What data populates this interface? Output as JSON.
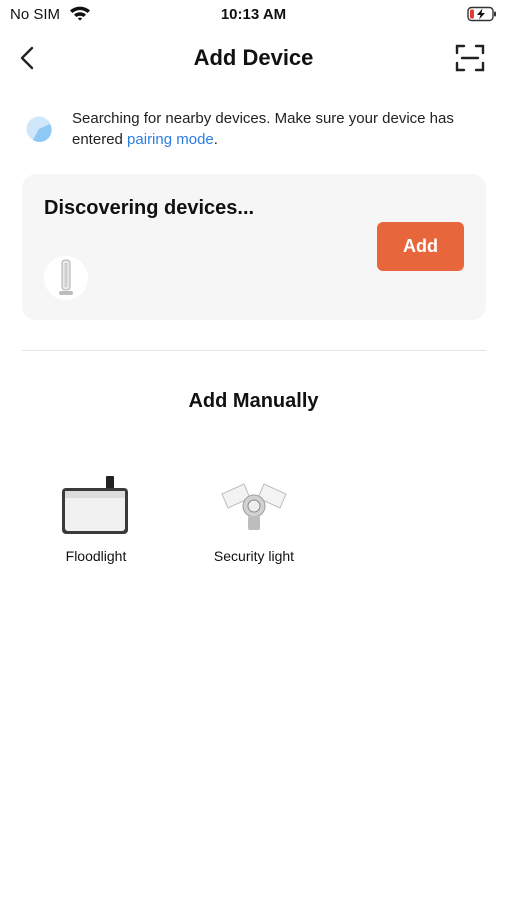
{
  "status_bar": {
    "carrier": "No SIM",
    "time": "10:13 AM",
    "wifi_icon": "wifi-icon",
    "battery_icon": "battery-charging-icon"
  },
  "nav": {
    "title": "Add Device",
    "back_icon": "chevron-left-icon",
    "scan_icon": "scan-icon"
  },
  "notice": {
    "text_before": "Searching for nearby devices. Make sure your device has entered ",
    "link": "pairing mode",
    "text_after": "."
  },
  "discover": {
    "title": "Discovering devices...",
    "add_label": "Add",
    "device_icon": "tower-fan-device-icon"
  },
  "manual": {
    "title": "Add Manually",
    "devices": [
      {
        "label": "Floodlight",
        "icon": "floodlight-icon"
      },
      {
        "label": "Security light",
        "icon": "security-light-icon"
      }
    ]
  },
  "colors": {
    "accent": "#e8663c",
    "link": "#2b7de0",
    "card_bg": "#f6f6f6"
  }
}
